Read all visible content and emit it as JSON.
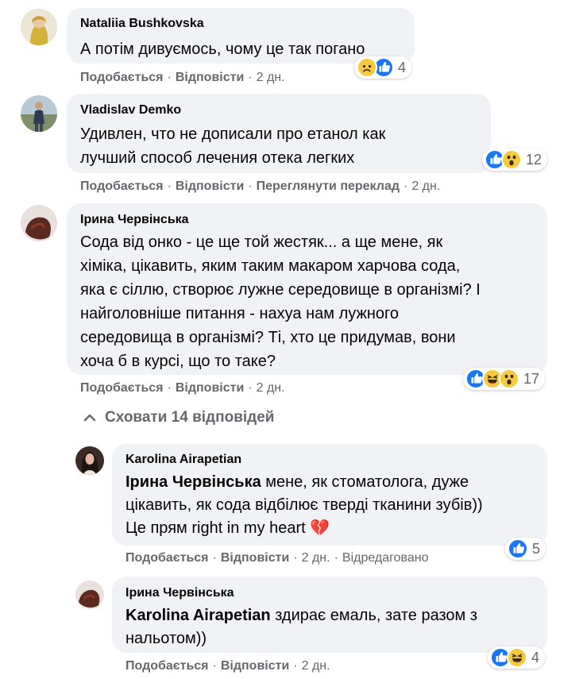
{
  "actions": {
    "like": "Подобається",
    "reply": "Відповісти",
    "see_translation": "Переглянути переклад",
    "edited": "Відредаговано",
    "separator": "·"
  },
  "comments": [
    {
      "author": "Nataliia Bushkovska",
      "lines": [
        "А потім дивуємось, чому це так погано"
      ],
      "time": "2 дн.",
      "reactions": [
        "sad",
        "like"
      ],
      "count": "4"
    },
    {
      "author": "Vladislav Demko",
      "lines": [
        "Удивлен, что не дописали про етанол как",
        "лучший способ лечения отека легких"
      ],
      "time": "2 дн.",
      "reactions": [
        "like",
        "wow"
      ],
      "count": "12"
    },
    {
      "author": "Ірина Червінська",
      "lines": [
        "Сода від онко - це ще той жестяк... а ще мене, як",
        "хіміка, цікавить, яким таким макаром харчова сода,",
        "яка є сіллю, створює лужне середовище в організмі? І",
        "найголовніше питання - нахуа нам лужного",
        "середовища в організмі? Ті, хто це придумав, вони",
        "хоча б в курсі, що то таке?"
      ],
      "time": "2 дн.",
      "reactions": [
        "like",
        "haha",
        "wow"
      ],
      "count": "17"
    }
  ],
  "hide_replies": "Сховати 14 відповідей",
  "replies": [
    {
      "author": "Karolina Airapetian",
      "mention": "Ірина Червінська",
      "line1_rest": " мене, як стоматолога, дуже",
      "line2": "цікавить, як сода відбілює тверді тканини зубів))",
      "line3": "Це прям right in my heart",
      "emoji": "💔",
      "time": "2 дн.",
      "reactions": [
        "like"
      ],
      "count": "5"
    },
    {
      "author": "Ірина Червінська",
      "mention": "Karolina Airapetian",
      "line1_rest": " здирає емаль, зате разом з",
      "line2": "нальотом))",
      "time": "2 дн.",
      "reactions": [
        "like",
        "haha"
      ],
      "count": "4"
    }
  ],
  "colors": {
    "like": "#1877f2",
    "reaction_yellow": "#f7c93e",
    "muted_text": "#65676b",
    "bubble": "#f0f2f5"
  }
}
